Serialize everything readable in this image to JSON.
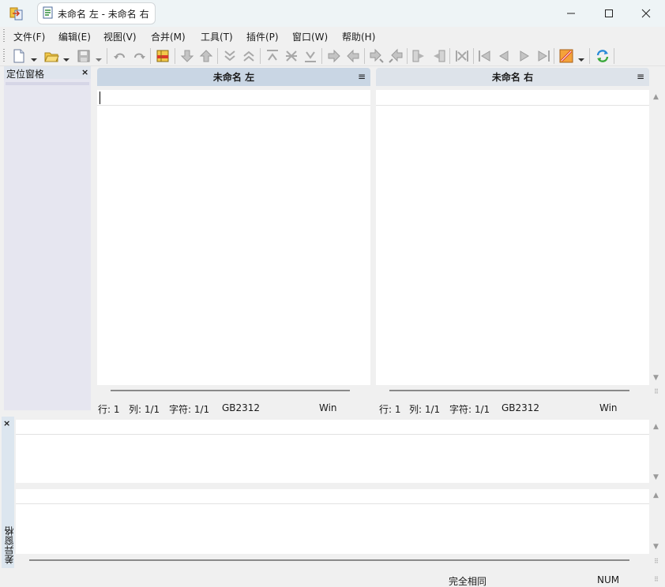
{
  "window": {
    "tab_title": "未命名 左 - 未命名 右",
    "minimize_icon": "minimize-icon",
    "maximize_icon": "maximize-icon",
    "close_icon": "close-icon"
  },
  "menu": {
    "items": [
      "文件(F)",
      "编辑(E)",
      "视图(V)",
      "合并(M)",
      "工具(T)",
      "插件(P)",
      "窗口(W)",
      "帮助(H)"
    ]
  },
  "location_pane": {
    "title": "定位窗格",
    "close": "×"
  },
  "left_pane": {
    "title": "未命名 左",
    "menu_glyph": "≡",
    "status": {
      "line": "行: 1",
      "col": "列: 1/1",
      "chars": "字符: 1/1",
      "encoding": "GB2312",
      "eol": "Win"
    }
  },
  "right_pane": {
    "title": "未命名 右",
    "menu_glyph": "≡",
    "status": {
      "line": "行: 1",
      "col": "列: 1/1",
      "chars": "字符: 1/1",
      "encoding": "GB2312",
      "eol": "Win"
    }
  },
  "diff_pane": {
    "label": "差异窗格",
    "close": "×"
  },
  "statusbar": {
    "result": "完全相同",
    "num": "NUM"
  },
  "colors": {
    "pane_header_active": "#c9d6e4",
    "pane_header_inactive": "#dde3ea",
    "location_pane_bg": "#e6e6f0",
    "diff_pane_sidebar": "#dce6ef"
  }
}
